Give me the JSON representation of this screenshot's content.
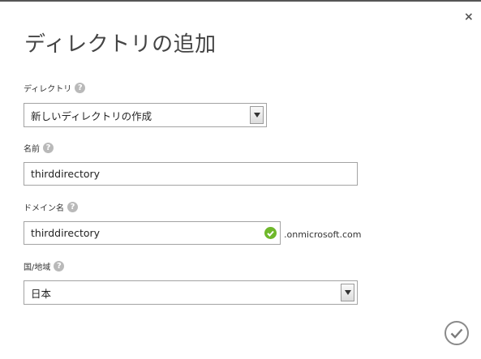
{
  "dialog": {
    "title": "ディレクトリの追加",
    "close_label": "×"
  },
  "fields": {
    "directory": {
      "label": "ディレクトリ",
      "selected": "新しいディレクトリの作成"
    },
    "name": {
      "label": "名前",
      "value": "thirddirectory"
    },
    "domain": {
      "label": "ドメイン名",
      "value": "thirddirectory",
      "suffix": ".onmicrosoft.com",
      "status": "valid"
    },
    "region": {
      "label": "国/地域",
      "selected": "日本"
    }
  },
  "help_glyph": "?",
  "icons": {
    "help": "help-icon",
    "dropdown": "chevron-down-icon",
    "valid": "checkmark-circle-icon",
    "confirm": "checkmark-icon",
    "close": "close-icon"
  },
  "colors": {
    "valid": "#6fb82b",
    "help": "#b9b9b9",
    "border": "#a3a3a3"
  }
}
